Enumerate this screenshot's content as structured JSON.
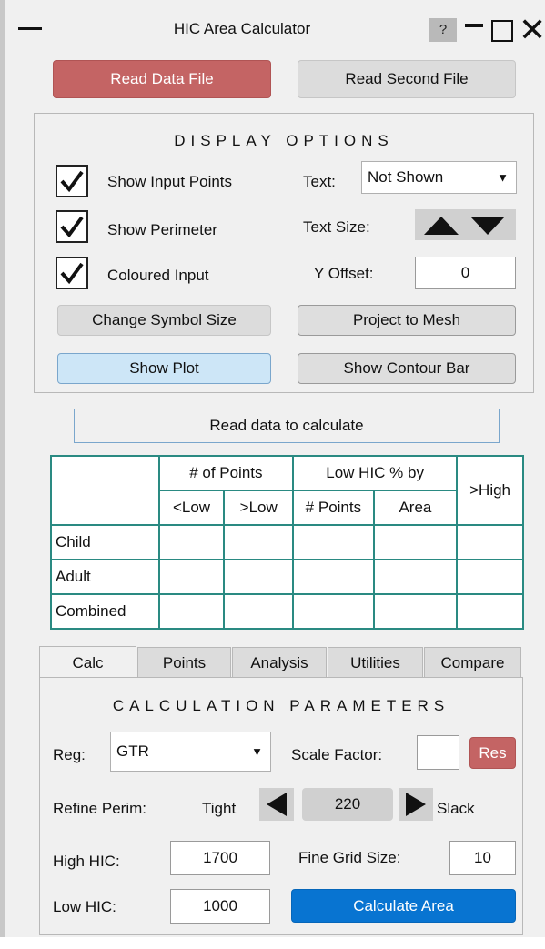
{
  "window": {
    "title": "HIC Area Calculator",
    "help_label": "?"
  },
  "toolbar": {
    "read_data_file": "Read Data File",
    "read_second_file": "Read Second File"
  },
  "display_options": {
    "heading": "DISPLAY OPTIONS",
    "show_input_points": {
      "label": "Show Input Points",
      "checked": true
    },
    "show_perimeter": {
      "label": "Show Perimeter",
      "checked": true
    },
    "coloured_input": {
      "label": "Coloured Input",
      "checked": true
    },
    "text_label": "Text:",
    "text_value": "Not Shown",
    "text_size_label": "Text Size:",
    "y_offset_label": "Y Offset:",
    "y_offset_value": "0",
    "change_symbol_size": "Change Symbol Size",
    "project_to_mesh": "Project to Mesh",
    "show_plot": "Show Plot",
    "show_contour_bar": "Show Contour Bar"
  },
  "status": "Read data to calculate",
  "results_table": {
    "group_headers": [
      "# of Points",
      "Low HIC % by",
      ">High"
    ],
    "sub_headers": [
      "<Low",
      ">Low",
      "# Points",
      "Area"
    ],
    "rows": [
      {
        "label": "Child",
        "cells": [
          "",
          "",
          "",
          "",
          ""
        ]
      },
      {
        "label": "Adult",
        "cells": [
          "",
          "",
          "",
          "",
          ""
        ]
      },
      {
        "label": "Combined",
        "cells": [
          "",
          "",
          "",
          "",
          ""
        ]
      }
    ]
  },
  "tabs": [
    "Calc",
    "Points",
    "Analysis",
    "Utilities",
    "Compare"
  ],
  "active_tab": "Calc",
  "calc": {
    "heading": "CALCULATION PARAMETERS",
    "reg_label": "Reg:",
    "reg_value": "GTR",
    "scale_factor_label": "Scale Factor:",
    "scale_factor_value": "",
    "res_label": "Res",
    "refine_perim_label": "Refine Perim:",
    "tight_label": "Tight",
    "refine_value": "220",
    "slack_label": "Slack",
    "high_hic_label": "High HIC:",
    "high_hic_value": "1700",
    "fine_grid_label": "Fine Grid Size:",
    "fine_grid_value": "10",
    "low_hic_label": "Low HIC:",
    "low_hic_value": "1000",
    "calculate_area": "Calculate Area"
  },
  "colors": {
    "accent_red": "#c46464",
    "primary_blue": "#0874d1",
    "table_border": "#2a8a82",
    "plot_button": "#cde6f7"
  }
}
